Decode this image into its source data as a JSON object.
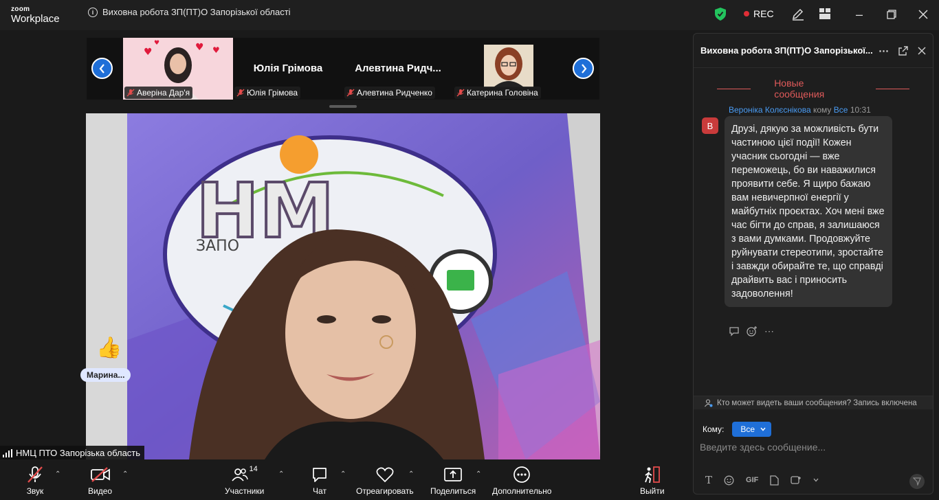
{
  "app": {
    "brand_small": "zoom",
    "brand_large": "Workplace"
  },
  "meeting": {
    "title": "Виховна робота ЗП(ПТ)О Запорізької області",
    "rec_label": "REC"
  },
  "participants_strip": [
    {
      "label": "Аверіна Дар'я",
      "big_name": ""
    },
    {
      "label": "Юлія Грімова",
      "big_name": "Юлія Грімова"
    },
    {
      "label": "Алевтина Ридченко",
      "big_name": "Алевтина  Ридч..."
    },
    {
      "label": "Катерина Головіна",
      "big_name": ""
    }
  ],
  "reaction": {
    "emoji": "👍",
    "name": "Марина..."
  },
  "self_view": {
    "label": "НМЦ ПТО Запорізька область"
  },
  "toolbar": {
    "audio": "Звук",
    "video": "Видео",
    "participants": "Участники",
    "participants_count": "14",
    "chat": "Чат",
    "react": "Отреагировать",
    "share": "Поделиться",
    "more": "Дополнительно",
    "leave": "Выйти"
  },
  "chat": {
    "title": "Виховна робота ЗП(ПТ)О Запорізької...",
    "new_messages": "Новые сообщения",
    "message": {
      "sender": "Вероніка Колєснікова",
      "to_word": "кому",
      "recipient": "Все",
      "time": "10:31",
      "avatar_letter": "В",
      "text": "Друзі, дякую за можливість бути частиною цієї події! Кожен учасник сьогодні — вже переможець, бо ви наважилися проявити себе. Я щиро бажаю вам невичерпної енергії у майбутніх проєктах. Хоч мені вже час бігти до справ, я залишаюся з вами думками. Продовжуйте руйнувати стереотипи, зростайте і завжди обирайте те, що справді драйвить вас і приносить задоволення!"
    },
    "privacy_notice": "Кто может видеть ваши сообщения? Запись включена",
    "to_label": "Кому:",
    "to_value": "Все",
    "input_placeholder": "Введите здесь сообщение...",
    "gif_label": "GIF"
  },
  "colors": {
    "accent": "#1f6fd8",
    "rec": "#e02e36",
    "new_messages": "#e05a5a",
    "shield": "#23c45e"
  }
}
